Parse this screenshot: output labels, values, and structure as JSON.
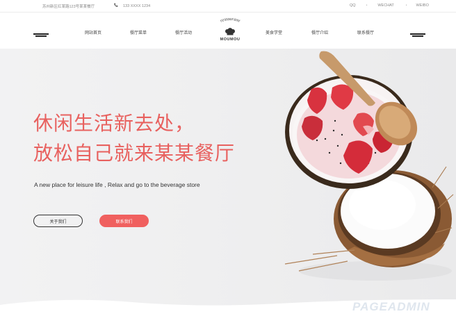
{
  "topbar": {
    "address": "苏州新区红某路123号某某餐厅",
    "phone_icon": "phone-icon",
    "phone": "133 XXXX 1234",
    "social": [
      "QQ",
      "WECHAT",
      "WEIBO"
    ],
    "separator": "•"
  },
  "nav": {
    "left_menu_icon": "menu-lines-icon",
    "right_menu_icon": "menu-lines-icon",
    "items_left": [
      "网站首页",
      "餐厅菜单",
      "餐厅活动"
    ],
    "items_right": [
      "美食学堂",
      "餐厅介绍",
      "联系餐厅"
    ],
    "logo": {
      "arc_text": "restaurant",
      "brand": "MOUMOU",
      "icon": "chef-hat-icon"
    }
  },
  "hero": {
    "headline_line1": "休闲生活新去处，",
    "headline_line2": "放松自己就来某某餐厅",
    "subtitle": "A new place for leisure life , Relax and go to the beverage store",
    "btn_about": "关于我们",
    "btn_contact": "联系我们",
    "image": "coconut-bowl-with-strawberries-and-wooden-spoon",
    "watermark": "PAGEADMIN"
  },
  "colors": {
    "accent": "#e8615f",
    "button_red": "#f0605f",
    "text": "#333333"
  }
}
